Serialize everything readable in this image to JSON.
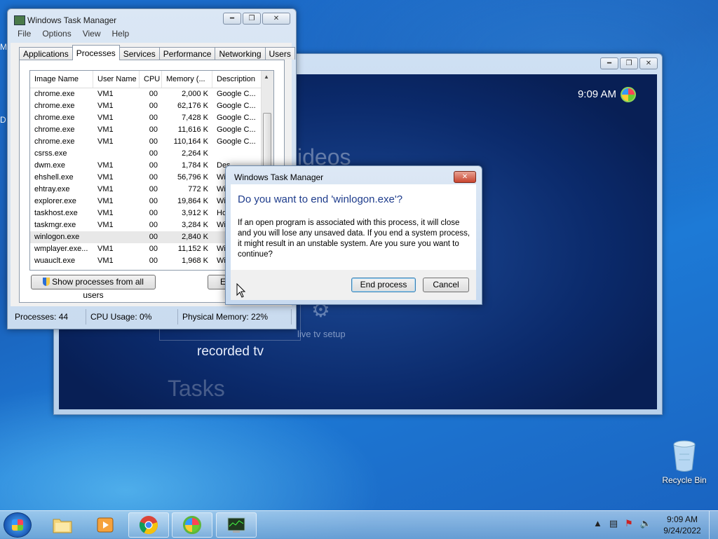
{
  "desktop": {
    "edge_stub_1": "M",
    "edge_stub_2": "D",
    "recycle_bin_label": "Recycle Bin"
  },
  "media_center": {
    "clock": "9:09 AM",
    "menu_text_videos": "ideos",
    "tile_label": "recorded tv",
    "live_tv_setup": "live tv setup",
    "tasks_text": "Tasks"
  },
  "task_manager": {
    "title": "Windows Task Manager",
    "menu": [
      "File",
      "Options",
      "View",
      "Help"
    ],
    "tabs": [
      "Applications",
      "Processes",
      "Services",
      "Performance",
      "Networking",
      "Users"
    ],
    "active_tab": "Processes",
    "columns": [
      "Image Name",
      "User Name",
      "CPU",
      "Memory (...",
      "Description"
    ],
    "rows": [
      {
        "image": "chrome.exe",
        "user": "VM1",
        "cpu": "00",
        "mem": "2,000 K",
        "desc": "Google C..."
      },
      {
        "image": "chrome.exe",
        "user": "VM1",
        "cpu": "00",
        "mem": "62,176 K",
        "desc": "Google C..."
      },
      {
        "image": "chrome.exe",
        "user": "VM1",
        "cpu": "00",
        "mem": "7,428 K",
        "desc": "Google C..."
      },
      {
        "image": "chrome.exe",
        "user": "VM1",
        "cpu": "00",
        "mem": "11,616 K",
        "desc": "Google C..."
      },
      {
        "image": "chrome.exe",
        "user": "VM1",
        "cpu": "00",
        "mem": "110,164 K",
        "desc": "Google C..."
      },
      {
        "image": "csrss.exe",
        "user": "",
        "cpu": "00",
        "mem": "2,264 K",
        "desc": ""
      },
      {
        "image": "dwm.exe",
        "user": "VM1",
        "cpu": "00",
        "mem": "1,784 K",
        "desc": "Des"
      },
      {
        "image": "ehshell.exe",
        "user": "VM1",
        "cpu": "00",
        "mem": "56,796 K",
        "desc": "Win"
      },
      {
        "image": "ehtray.exe",
        "user": "VM1",
        "cpu": "00",
        "mem": "772 K",
        "desc": "Win"
      },
      {
        "image": "explorer.exe",
        "user": "VM1",
        "cpu": "00",
        "mem": "19,864 K",
        "desc": "Win"
      },
      {
        "image": "taskhost.exe",
        "user": "VM1",
        "cpu": "00",
        "mem": "3,912 K",
        "desc": "Hos"
      },
      {
        "image": "taskmgr.exe",
        "user": "VM1",
        "cpu": "00",
        "mem": "3,284 K",
        "desc": "Win"
      },
      {
        "image": "winlogon.exe",
        "user": "",
        "cpu": "00",
        "mem": "2,840 K",
        "desc": ""
      },
      {
        "image": "wmplayer.exe...",
        "user": "VM1",
        "cpu": "00",
        "mem": "11,152 K",
        "desc": "Win"
      },
      {
        "image": "wuauclt.exe",
        "user": "VM1",
        "cpu": "00",
        "mem": "1,968 K",
        "desc": "Win"
      }
    ],
    "selected_row": 12,
    "show_all_button": "Show processes from all users",
    "end_process_stub": "E",
    "status": {
      "processes": "Processes: 44",
      "cpu": "CPU Usage: 0%",
      "memory": "Physical Memory: 22%"
    }
  },
  "dialog": {
    "title": "Windows Task Manager",
    "question": "Do you want to end 'winlogon.exe'?",
    "message": "If an open program is associated with this process, it will close and you will lose any unsaved data. If you end a system process, it might result in an unstable system. Are you sure you want to continue?",
    "end_button": "End process",
    "cancel_button": "Cancel"
  },
  "taskbar": {
    "clock_time": "9:09 AM",
    "clock_date": "9/24/2022",
    "pinned": [
      "explorer-icon",
      "media-player-icon",
      "chrome-icon",
      "media-center-icon",
      "task-manager-icon"
    ]
  }
}
